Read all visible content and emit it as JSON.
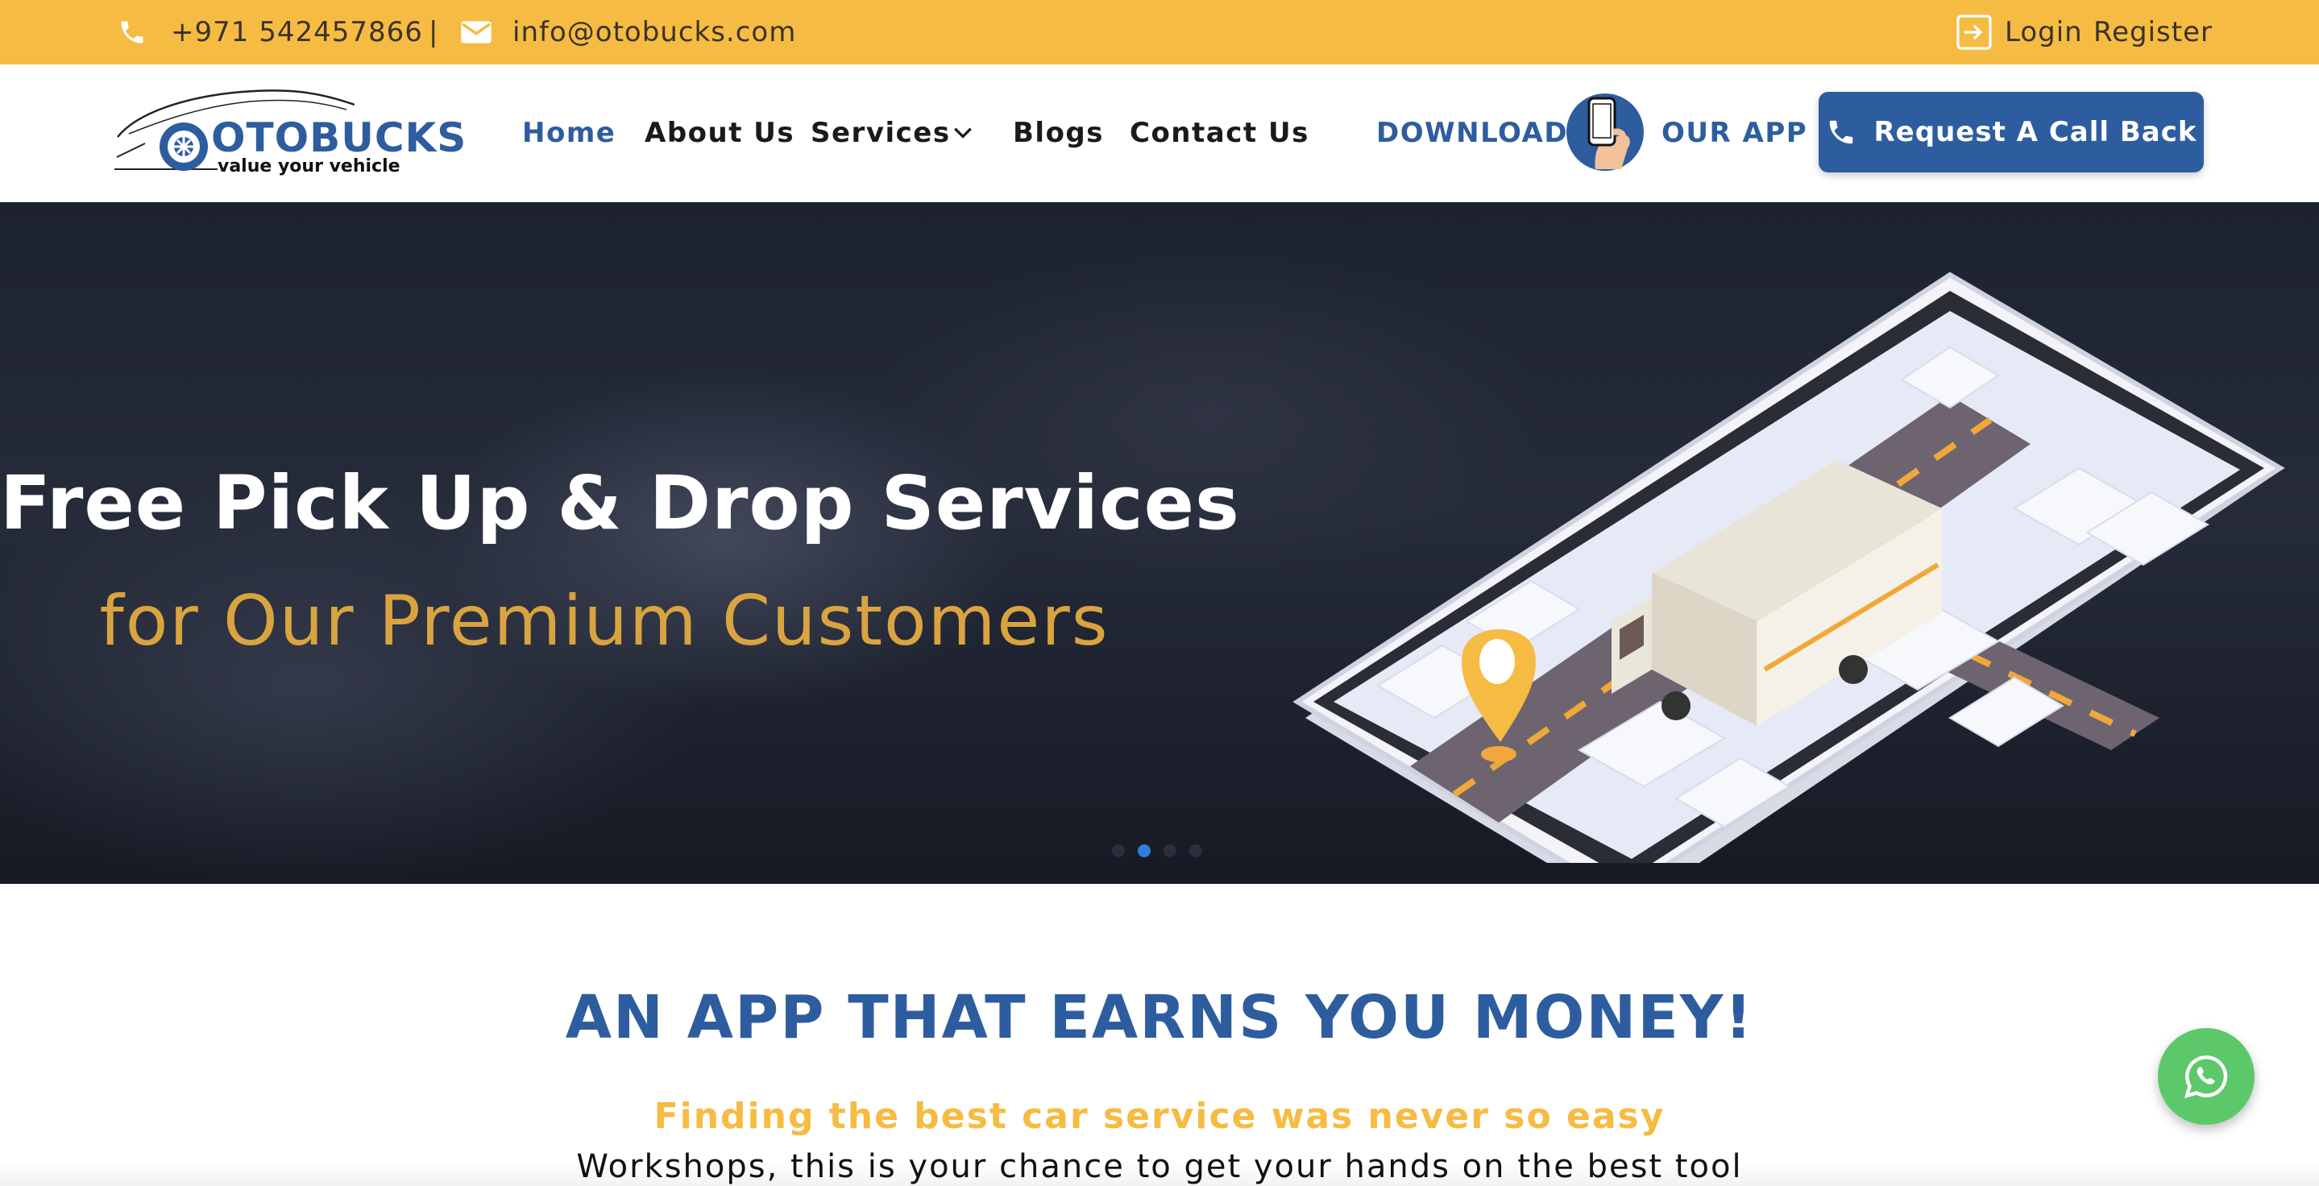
{
  "topbar": {
    "phone": "+971 542457866",
    "separator": "|",
    "email": "info@otobucks.com",
    "login_label": "Login",
    "register_label": "Register",
    "icons": [
      "phone-icon",
      "mail-icon",
      "login-icon"
    ]
  },
  "header": {
    "logo_text": "OTOBUCKS",
    "logo_tagline": "value your vehicle",
    "nav": [
      {
        "label": "Home",
        "active": true
      },
      {
        "label": "About Us",
        "active": false
      },
      {
        "label": "Services",
        "active": false,
        "has_dropdown": true
      },
      {
        "label": "Blogs",
        "active": false
      },
      {
        "label": "Contact Us",
        "active": false
      }
    ],
    "download_label": "DOWNLOAD",
    "our_app_label": "OUR APP",
    "callback_label": "Request A Call Back"
  },
  "hero": {
    "title": "Free Pick Up & Drop Services",
    "subtitle": "for Our Premium Customers",
    "slides": 4,
    "active_slide": 2
  },
  "section": {
    "title": "AN APP THAT EARNS YOU MONEY!",
    "subtitle": "Finding the best car service was never so easy",
    "body": "Workshops, this is your chance to get your hands on the best tool"
  },
  "colors": {
    "topbar": "#f6bb42",
    "brand_blue": "#2e5d9f",
    "gold_text": "#d9a440",
    "whatsapp": "#5cc86a"
  }
}
